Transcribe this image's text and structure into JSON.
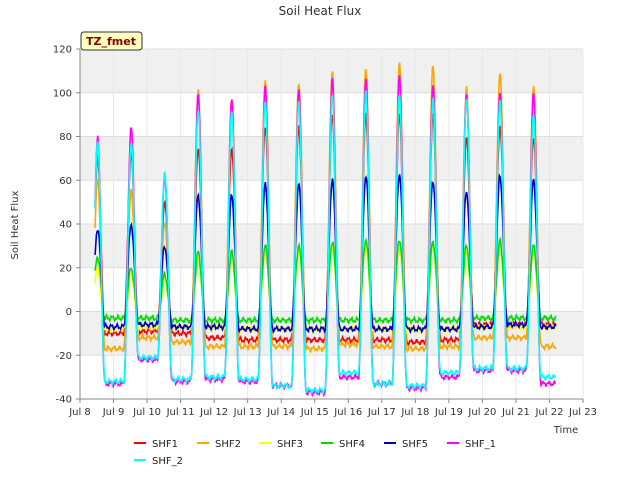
{
  "chart_data": {
    "type": "line",
    "title": "Soil Heat Flux",
    "xlabel": "Time",
    "ylabel": "Soil Heat Flux",
    "annotation": "TZ_fmet",
    "xlim": [
      8,
      23
    ],
    "ylim": [
      -40,
      120
    ],
    "x_ticks": [
      {
        "v": 8,
        "label": "Jul 8"
      },
      {
        "v": 9,
        "label": "Jul 9"
      },
      {
        "v": 10,
        "label": "Jul 10"
      },
      {
        "v": 11,
        "label": "Jul 11"
      },
      {
        "v": 12,
        "label": "Jul 12"
      },
      {
        "v": 13,
        "label": "Jul 13"
      },
      {
        "v": 14,
        "label": "Jul 14"
      },
      {
        "v": 15,
        "label": "Jul 15"
      },
      {
        "v": 16,
        "label": "Jul 16"
      },
      {
        "v": 17,
        "label": "Jul 17"
      },
      {
        "v": 18,
        "label": "Jul 18"
      },
      {
        "v": 19,
        "label": "Jul 19"
      },
      {
        "v": 20,
        "label": "Jul 20"
      },
      {
        "v": 21,
        "label": "Jul 21"
      },
      {
        "v": 22,
        "label": "Jul 22"
      },
      {
        "v": 23,
        "label": "Jul 23"
      }
    ],
    "y_ticks": [
      -40,
      -20,
      0,
      20,
      40,
      60,
      80,
      100,
      120
    ],
    "grid": true,
    "legend_position": "bottom",
    "days": [
      8.5,
      9.5,
      10.5,
      11.5,
      12.5,
      13.5,
      14.5,
      15.5,
      16.5,
      17.5,
      18.5,
      19.5,
      20.5,
      21.5
    ],
    "series": [
      {
        "name": "SHF1",
        "color": "#ff0000",
        "night": [
          -12,
          -10,
          -9,
          -10,
          -12,
          -13,
          -13,
          -13,
          -13,
          -13,
          -14,
          -13,
          -6,
          -6,
          -6
        ],
        "peaks": [
          70,
          72,
          50,
          75,
          75,
          85,
          85,
          90,
          90,
          90,
          90,
          80,
          85,
          80
        ]
      },
      {
        "name": "SHF2",
        "color": "#ffa500",
        "night": [
          -17,
          -17,
          -12,
          -14,
          -16,
          -16,
          -16,
          -17,
          -15,
          -16,
          -17,
          -16,
          -12,
          -12,
          -16
        ],
        "peaks": [
          60,
          55,
          40,
          101,
          98,
          106,
          105,
          110,
          111,
          113,
          112,
          102,
          109,
          103
        ]
      },
      {
        "name": "SHF3",
        "color": "#ffff00",
        "night": [
          -8,
          -8,
          -7,
          -7,
          -7,
          -8,
          -8,
          -8,
          -8,
          -8,
          -8,
          -8,
          -7,
          -7,
          -7
        ],
        "peaks": [
          20,
          18,
          15,
          25,
          25,
          28,
          28,
          30,
          30,
          30,
          30,
          28,
          30,
          28
        ]
      },
      {
        "name": "SHF4",
        "color": "#00dd00",
        "night": [
          -3,
          -3,
          -3,
          -4,
          -4,
          -4,
          -4,
          -4,
          -4,
          -4,
          -4,
          -4,
          -3,
          -3,
          -3
        ],
        "peaks": [
          25,
          20,
          17,
          27,
          27,
          30,
          30,
          32,
          33,
          33,
          32,
          30,
          32,
          30
        ]
      },
      {
        "name": "SHF5",
        "color": "#0000cc",
        "night": [
          -7,
          -7,
          -6,
          -7,
          -7,
          -8,
          -8,
          -8,
          -8,
          -8,
          -8,
          -8,
          -7,
          -6,
          -7
        ],
        "peaks": [
          38,
          40,
          30,
          53,
          53,
          58,
          58,
          60,
          62,
          63,
          60,
          55,
          62,
          60
        ]
      },
      {
        "name": "SHF_1",
        "color": "#ff00ff",
        "night": [
          -34,
          -33,
          -22,
          -32,
          -31,
          -32,
          -34,
          -37,
          -30,
          -33,
          -35,
          -30,
          -27,
          -27,
          -33
        ],
        "peaks": [
          80,
          85,
          62,
          100,
          97,
          103,
          101,
          106,
          106,
          108,
          104,
          100,
          101,
          100
        ]
      },
      {
        "name": "SHF_2",
        "color": "#00ffff",
        "night": [
          -32,
          -32,
          -21,
          -31,
          -30,
          -31,
          -34,
          -36,
          -28,
          -33,
          -34,
          -28,
          -26,
          -26,
          -30
        ],
        "peaks": [
          77,
          77,
          64,
          93,
          92,
          97,
          96,
          99,
          100,
          99,
          97,
          98,
          97,
          91
        ]
      }
    ]
  }
}
